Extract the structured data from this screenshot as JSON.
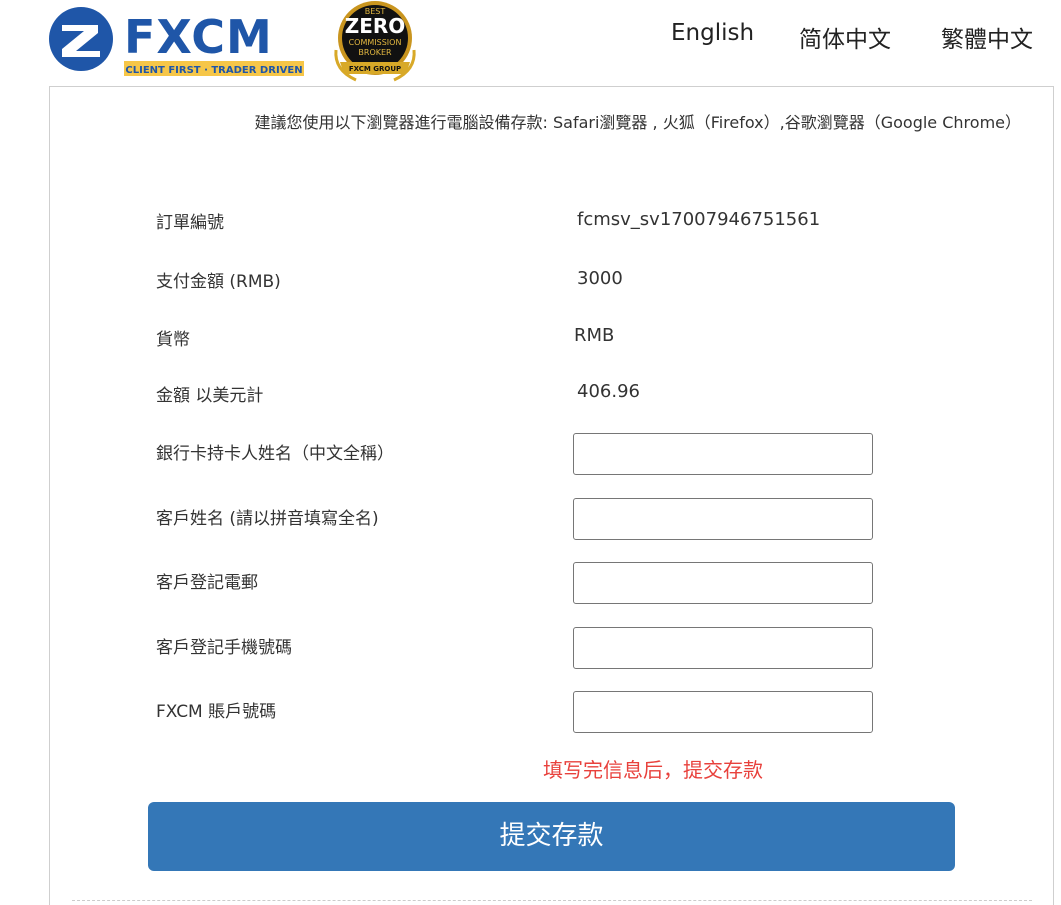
{
  "header": {
    "logo_text": "FXCM",
    "logo_tagline": "CLIENT FIRST · TRADER DRIVEN",
    "badge": {
      "line1": "BEST",
      "line2": "ZERO",
      "line3": "COMMISSION",
      "line4": "BROKER",
      "ribbon": "FXCM GROUP"
    },
    "languages": [
      "English",
      "简体中文",
      "繁體中文"
    ],
    "brand_color": "#1f56a8",
    "tagline_bg": "#f6c648"
  },
  "notice": "建議您使用以下瀏覽器進行電腦設備存款: Safari瀏覽器 , 火狐（Firefox）,谷歌瀏覽器（Google Chrome）",
  "info_rows": [
    {
      "label": "訂單編號",
      "value": "fcmsv_sv17007946751561"
    },
    {
      "label": "支付金額 (RMB)",
      "value": "3000"
    },
    {
      "label": "貨幣",
      "value": "RMB"
    },
    {
      "label": "金額 以美元計",
      "value": "406.96"
    }
  ],
  "form_fields": [
    {
      "label": "銀行卡持卡人姓名（中文全稱）",
      "value": ""
    },
    {
      "label": "客戶姓名 (請以拼音填寫全名)",
      "value": ""
    },
    {
      "label": "客戶登記電郵",
      "value": ""
    },
    {
      "label": "客戶登記手機號碼",
      "value": ""
    },
    {
      "label": "FXCM 賬戶號碼",
      "value": ""
    }
  ],
  "hint": "填写完信息后，提交存款",
  "submit_label": "提交存款",
  "colors": {
    "submit_bg": "#3477b7",
    "hint": "#e8413c"
  }
}
